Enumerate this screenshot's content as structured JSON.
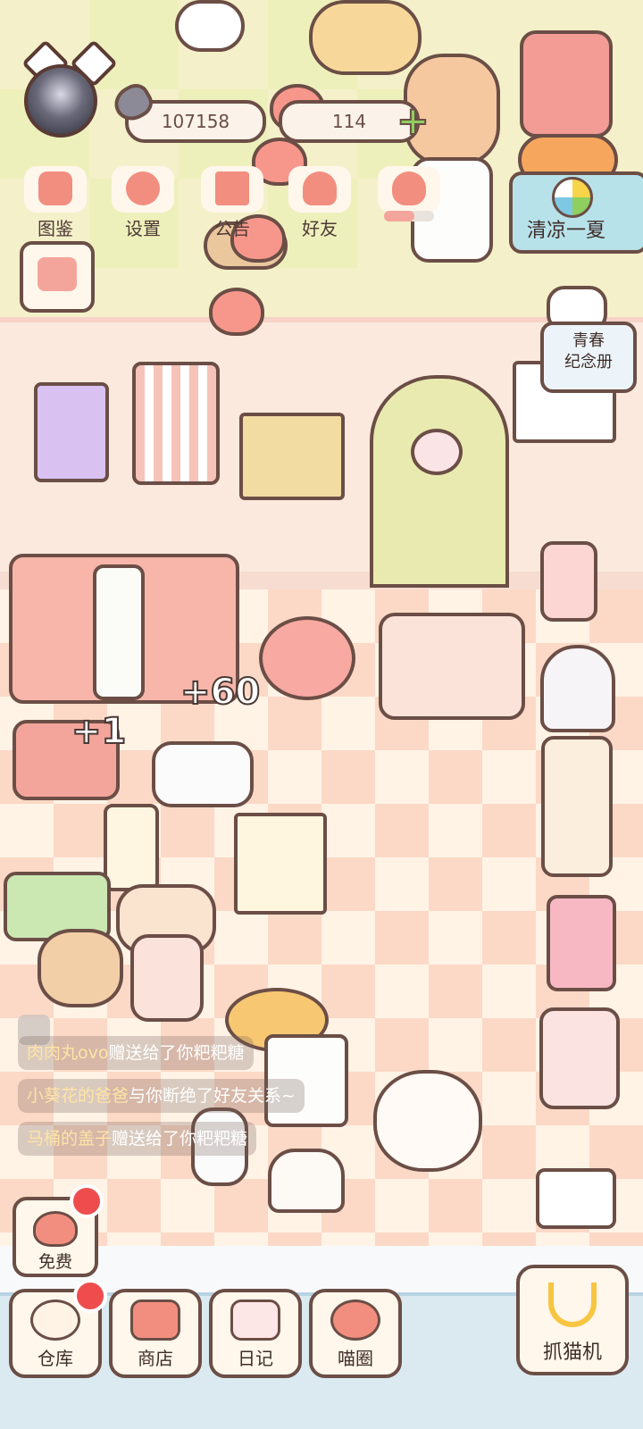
{
  "hud": {
    "coins": "107158",
    "hearts": "114"
  },
  "menu": [
    {
      "label": "图鉴",
      "icon": "cat-book-icon"
    },
    {
      "label": "设置",
      "icon": "gear-icon"
    },
    {
      "label": "公告",
      "icon": "gift-icon"
    },
    {
      "label": "好友",
      "icon": "friends-icon"
    },
    {
      "label": "",
      "icon": "heart-mail-icon"
    }
  ],
  "event": {
    "label": "清凉一夏"
  },
  "album": {
    "label_line1": "青春",
    "label_line2": "纪念册"
  },
  "floats": {
    "plus_a": "+60",
    "plus_b": "+1"
  },
  "chat": [
    {
      "name": "肉肉丸ovo",
      "text": "赠送给了你粑粑糖"
    },
    {
      "name": "小葵花的爸爸",
      "text": "与你断绝了好友关系~"
    },
    {
      "name": "马桶的盖子",
      "text": "赠送给了你粑粑糖"
    }
  ],
  "free": {
    "label": "免费"
  },
  "bottom_bar": [
    {
      "label": "仓库",
      "icon": "storage-icon"
    },
    {
      "label": "商店",
      "icon": "shop-icon"
    },
    {
      "label": "日记",
      "icon": "diary-icon"
    },
    {
      "label": "喵圈",
      "icon": "cat-planet-icon"
    }
  ],
  "claw_machine": {
    "label": "抓猫机"
  },
  "colors": {
    "outline": "#6b4e46",
    "pink": "#f28e7f",
    "alert": "#ef4d4d",
    "event_blue": "#b8e2ea"
  }
}
